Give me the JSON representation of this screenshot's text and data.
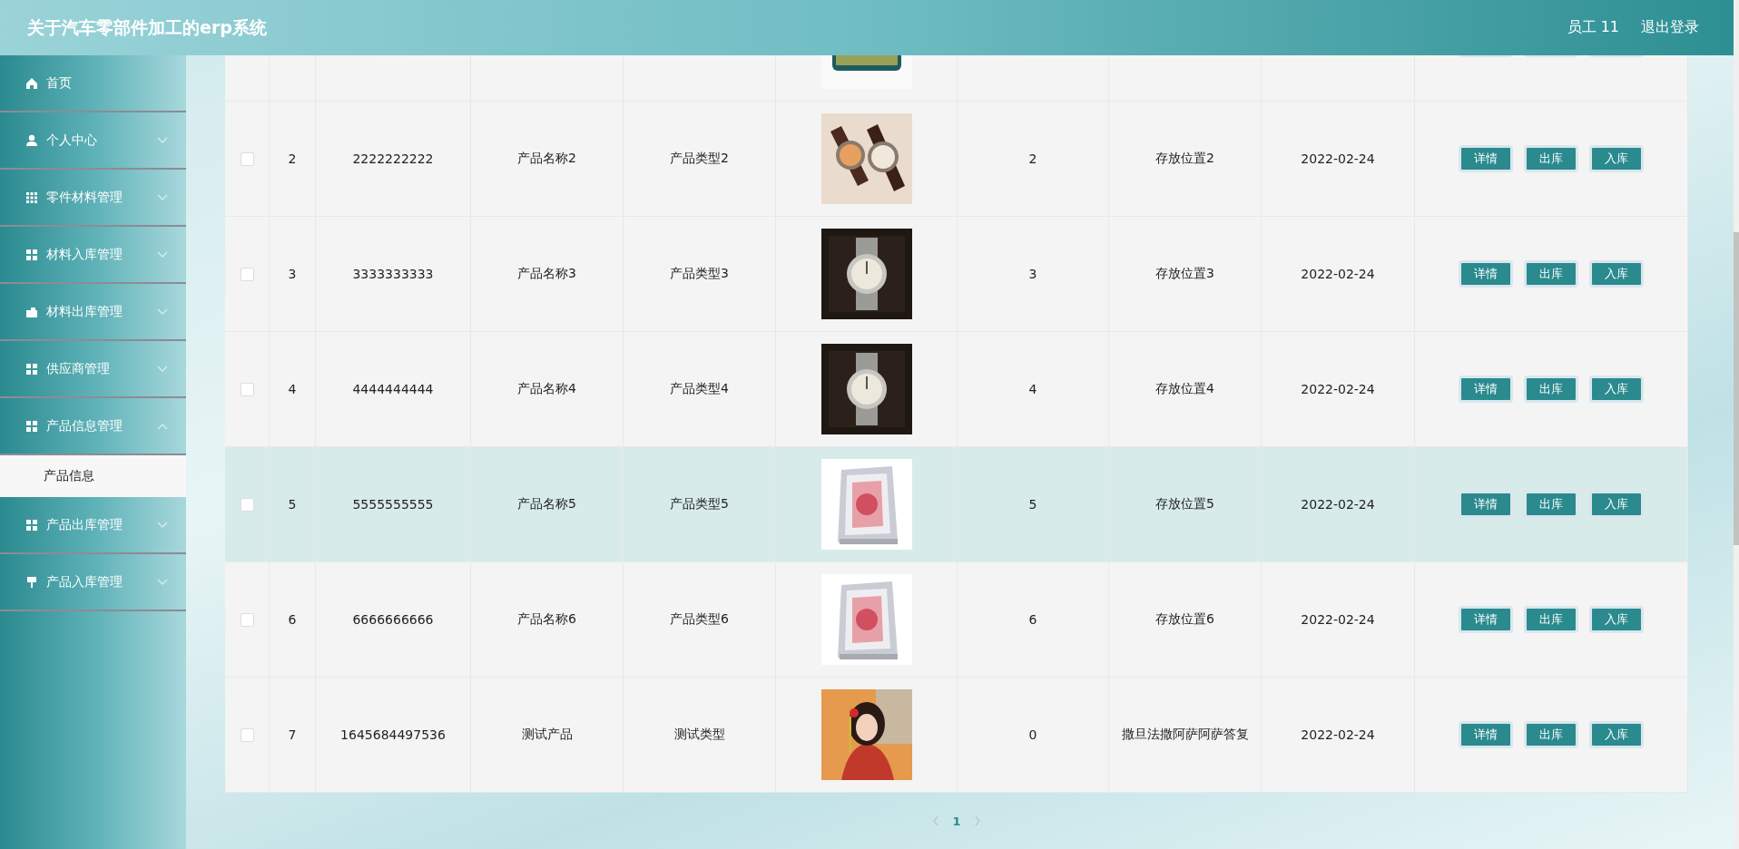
{
  "header": {
    "title": "关于汽车零部件加工的erp系统",
    "user": "员工 11",
    "logout": "退出登录"
  },
  "sidebar": {
    "items": [
      {
        "label": "首页",
        "kind": "link"
      },
      {
        "label": "个人中心",
        "kind": "submenu",
        "expanded": false
      },
      {
        "label": "零件材料管理",
        "kind": "submenu",
        "expanded": false
      },
      {
        "label": "材料入库管理",
        "kind": "submenu",
        "expanded": false
      },
      {
        "label": "材料出库管理",
        "kind": "submenu",
        "expanded": false
      },
      {
        "label": "供应商管理",
        "kind": "submenu",
        "expanded": false
      },
      {
        "label": "产品信息管理",
        "kind": "submenu",
        "expanded": true,
        "children": [
          {
            "label": "产品信息",
            "selected": true
          }
        ]
      },
      {
        "label": "产品出库管理",
        "kind": "submenu",
        "expanded": false
      },
      {
        "label": "产品入库管理",
        "kind": "submenu",
        "expanded": false
      }
    ]
  },
  "table": {
    "partial_row": {
      "image": {
        "kind": "picture"
      },
      "actions": [
        {
          "kind": "button"
        },
        {
          "kind": "button"
        },
        {
          "kind": "button"
        }
      ]
    },
    "rows": [
      {
        "checked": false,
        "highlighted": false,
        "cells_before": [
          "2",
          "2222222222",
          "产品名称2",
          "产品类型2"
        ],
        "image": {
          "kind": "picture"
        },
        "cells_after": [
          "2",
          "存放位置2",
          "2022-02-24"
        ],
        "actions": [
          "详情",
          "出库",
          "入库"
        ]
      },
      {
        "checked": false,
        "highlighted": false,
        "cells_before": [
          "3",
          "3333333333",
          "产品名称3",
          "产品类型3"
        ],
        "image": {
          "kind": "picture"
        },
        "cells_after": [
          "3",
          "存放位置3",
          "2022-02-24"
        ],
        "actions": [
          "详情",
          "出库",
          "入库"
        ]
      },
      {
        "checked": false,
        "highlighted": false,
        "cells_before": [
          "4",
          "4444444444",
          "产品名称4",
          "产品类型4"
        ],
        "image": {
          "kind": "picture"
        },
        "cells_after": [
          "4",
          "存放位置4",
          "2022-02-24"
        ],
        "actions": [
          "详情",
          "出库",
          "入库"
        ]
      },
      {
        "checked": false,
        "highlighted": true,
        "cells_before": [
          "5",
          "5555555555",
          "产品名称5",
          "产品类型5"
        ],
        "image": {
          "kind": "picture"
        },
        "cells_after": [
          "5",
          "存放位置5",
          "2022-02-24"
        ],
        "actions": [
          "详情",
          "出库",
          "入库"
        ]
      },
      {
        "checked": false,
        "highlighted": false,
        "cells_before": [
          "6",
          "6666666666",
          "产品名称6",
          "产品类型6"
        ],
        "image": {
          "kind": "picture"
        },
        "cells_after": [
          "6",
          "存放位置6",
          "2022-02-24"
        ],
        "actions": [
          "详情",
          "出库",
          "入库"
        ]
      },
      {
        "checked": false,
        "highlighted": false,
        "cells_before": [
          "7",
          "1645684497536",
          "测试产品",
          "测试类型"
        ],
        "image": {
          "kind": "picture"
        },
        "cells_after": [
          "0",
          "撒旦法撒阿萨阿萨答复",
          "2022-02-24"
        ],
        "actions": [
          "详情",
          "出库",
          "入库"
        ]
      }
    ]
  },
  "pagination": {
    "pages": [
      {
        "label": "1",
        "selected": true
      }
    ]
  }
}
